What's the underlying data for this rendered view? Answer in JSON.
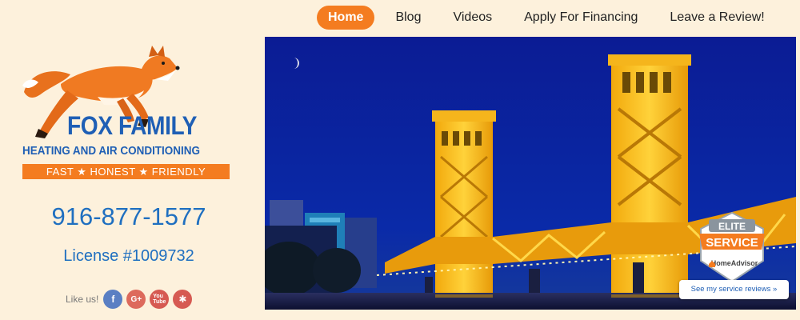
{
  "nav": {
    "items": [
      {
        "label": "Home",
        "active": true
      },
      {
        "label": "Blog",
        "active": false
      },
      {
        "label": "Videos",
        "active": false
      },
      {
        "label": "Apply For Financing",
        "active": false
      },
      {
        "label": "Leave a Review!",
        "active": false
      }
    ]
  },
  "logo": {
    "title": "FOX FAMILY",
    "subtitle": "HEATING AND AIR CONDITIONING",
    "tagline": "FAST ★ HONEST ★ FRIENDLY"
  },
  "contact": {
    "phone": "916-877-1577",
    "license": "License #1009732"
  },
  "social": {
    "label": "Like us!",
    "icons": [
      "facebook-icon",
      "google-plus-icon",
      "youtube-icon",
      "yelp-icon"
    ]
  },
  "badge": {
    "top": "ELITE",
    "main": "SERVICE",
    "brand": "HomeAdvisor",
    "link": "See my service reviews »"
  },
  "colors": {
    "accent": "#f47c20",
    "brand_blue": "#1f5fb5",
    "background": "#fdf1dc"
  }
}
